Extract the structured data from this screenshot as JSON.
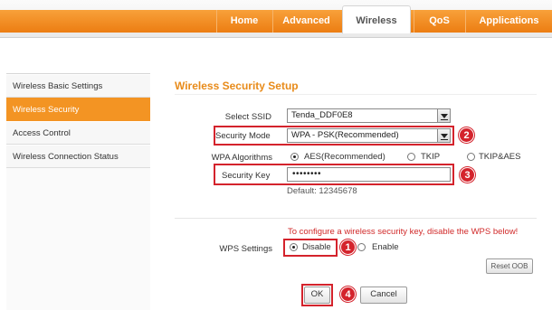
{
  "nav": {
    "tabs": [
      {
        "label": "Home"
      },
      {
        "label": "Advanced"
      },
      {
        "label": "Wireless"
      },
      {
        "label": "QoS"
      },
      {
        "label": "Applications"
      }
    ],
    "active_tab": "Wireless"
  },
  "sidebar": {
    "items": [
      {
        "label": "Wireless Basic Settings"
      },
      {
        "label": "Wireless Security"
      },
      {
        "label": "Access Control"
      },
      {
        "label": "Wireless Connection Status"
      }
    ],
    "active_item": "Wireless Security"
  },
  "main": {
    "title": "Wireless Security Setup",
    "ssid": {
      "label": "Select SSID",
      "value": "Tenda_DDF0E8"
    },
    "security_mode": {
      "label": "Security Mode",
      "value": "WPA - PSK(Recommended)"
    },
    "wpa_algorithms": {
      "label": "WPA Algorithms",
      "options": [
        {
          "label": "AES(Recommended)",
          "selected": true
        },
        {
          "label": "TKIP",
          "selected": false
        },
        {
          "label": "TKIP&AES",
          "selected": false
        }
      ]
    },
    "security_key": {
      "label": "Security Key",
      "value": "••••••••",
      "default_text": "Default: 12345678"
    },
    "wps": {
      "warning": "To configure a wireless security key, disable the WPS below!",
      "label": "WPS Settings",
      "options": [
        {
          "label": "Disable",
          "selected": true
        },
        {
          "label": "Enable",
          "selected": false
        }
      ],
      "reset_label": "Reset OOB"
    },
    "ok_label": "OK",
    "cancel_label": "Cancel"
  },
  "annotations": {
    "step_badges": [
      "1",
      "2",
      "3",
      "4"
    ],
    "highlight_color": "#d4232c"
  },
  "colors": {
    "accent_orange": "#f39423",
    "title_orange": "#e88b1a",
    "warning_red": "#d12a2a"
  }
}
